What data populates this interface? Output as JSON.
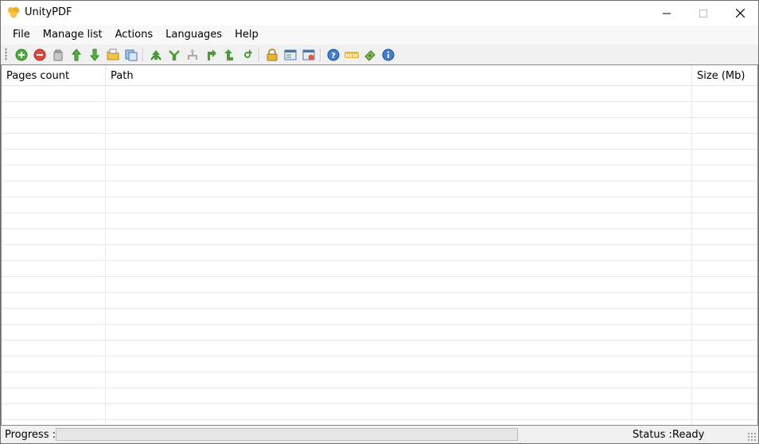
{
  "window": {
    "title": "UnityPDF",
    "controls": {
      "minimize": "—",
      "maximize": "☐",
      "close": "✕"
    }
  },
  "menu": [
    "File",
    "Manage list",
    "Actions",
    "Languages",
    "Help"
  ],
  "toolbar": {
    "groups": [
      [
        "add-icon",
        "remove-icon",
        "clear-icon",
        "move-up-icon",
        "move-down-icon",
        "open-folder-icon",
        "save-list-icon"
      ],
      [
        "merge-icon",
        "split-icon",
        "extract-icon",
        "rotate-right-icon",
        "rotate-up-icon",
        "rotate-back-icon"
      ],
      [
        "lock-icon",
        "properties-icon",
        "settings-icon"
      ],
      [
        "help-icon",
        "new-icon",
        "donate-icon",
        "info-icon"
      ]
    ]
  },
  "table": {
    "columns": [
      "Pages count",
      "Path",
      "Size (Mb)"
    ],
    "rows": []
  },
  "statusbar": {
    "progress_label": "Progress :",
    "progress_value": 0,
    "status_label": "Status :",
    "status_value": "Ready"
  },
  "colors": {
    "progress_fill": "#06b025",
    "icon_green": "#3e9f2b",
    "icon_red": "#d9342b",
    "icon_blue": "#2a6ebb",
    "icon_gold": "#e0a220"
  }
}
